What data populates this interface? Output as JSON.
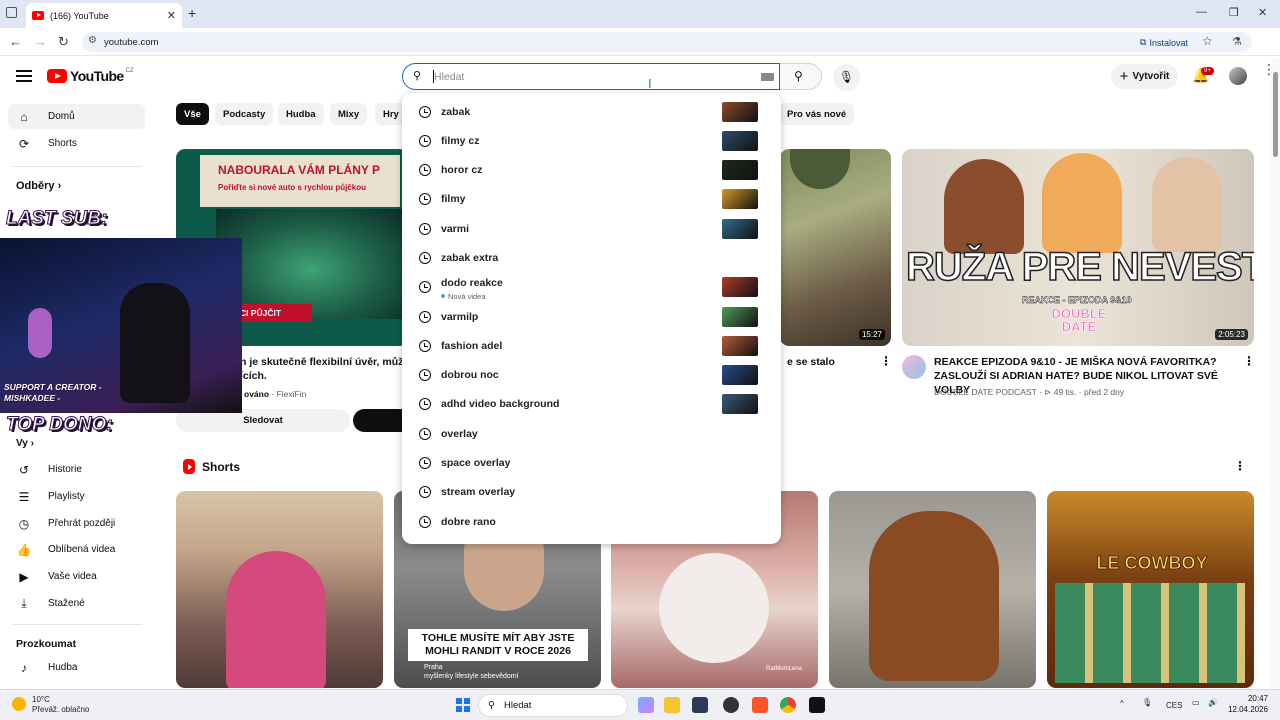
{
  "browser": {
    "tab_title": "(166) YouTube",
    "url": "youtube.com",
    "install_label": "Instalovat"
  },
  "header": {
    "logo_text": "YouTube",
    "country": "CZ",
    "search_placeholder": "Hledat",
    "create_label": "Vytvořit",
    "notifications": "9+"
  },
  "sidebar": {
    "top": [
      {
        "label": "Domů",
        "icon": "home-icon"
      },
      {
        "label": "Shorts",
        "icon": "shorts-icon"
      }
    ],
    "subs_heading": "Odběry",
    "you_heading": "Vy",
    "you": [
      {
        "label": "Historie",
        "icon": "history-icon"
      },
      {
        "label": "Playlisty",
        "icon": "playlist-icon"
      },
      {
        "label": "Přehrát později",
        "icon": "watch-later-icon"
      },
      {
        "label": "Oblíbená videa",
        "icon": "like-icon"
      },
      {
        "label": "Vaše videa",
        "icon": "your-videos-icon"
      },
      {
        "label": "Stažené",
        "icon": "download-icon"
      }
    ],
    "explore_heading": "Prozkoumat",
    "explore": [
      {
        "label": "Hudba",
        "icon": "music-icon"
      }
    ]
  },
  "chips": [
    "Vše",
    "Podcasty",
    "Hudba",
    "Mixy",
    "Hry",
    "Pro vás nové"
  ],
  "search_suggestions": [
    {
      "text": "zabak"
    },
    {
      "text": "filmy cz"
    },
    {
      "text": "horor cz"
    },
    {
      "text": "filmy"
    },
    {
      "text": "varmi"
    },
    {
      "text": "zabak extra"
    },
    {
      "text": "dodo reakce",
      "sub": "Nová videa"
    },
    {
      "text": "varmilp"
    },
    {
      "text": "fashion adel"
    },
    {
      "text": "dobrou noc"
    },
    {
      "text": "adhd video background"
    },
    {
      "text": "overlay"
    },
    {
      "text": "space overlay"
    },
    {
      "text": "stream overlay"
    },
    {
      "text": "dobre rano"
    }
  ],
  "videos": {
    "ad": {
      "banner_line1": "NABOURALA VÁM PLÁNY P",
      "banner_line2": "Pořiďte si nové auto s rychlou půjčkou",
      "cta_partial": "CI PŮJČIT",
      "title_partial": "n je skutečně flexibilní úvěr, můžet",
      "title_partial2": "ících.",
      "sponsor": "ováno",
      "advertiser": "FlexiFin",
      "follow_label": "Sledovat"
    },
    "second": {
      "duration": "15:27",
      "title_partial": "e se stalo"
    },
    "third": {
      "thumb_big": "RUŽA PRE NEVESTU",
      "thumb_small": "REAKCE - EPIZODA 9&10",
      "thumb_logo": "DOUBLE DATE",
      "duration": "2:05:23",
      "title": "REAKCE EPIZODA 9&10 - JE MIŠKA NOVÁ FAVORITKA? ZASLOUŽÍ SI ADRIAN HATE? BUDE NIKOL LITOVAT SVÉ VOLBY",
      "channel": "DOUBLE DATE PODCAST",
      "views": "49 tis.",
      "age": "před 2 dny"
    }
  },
  "shorts": {
    "heading": "Shorts",
    "caption2": "TOHLE MUSÍTE MÍT ABY JSTE MOHLI RANDIT V ROCE 2026",
    "sub2_line1": "Praha",
    "sub2_line2": "myšlenky lifestyle sebevědomí",
    "watermark3": "RatMomLena",
    "title5": "LE COWBOY"
  },
  "overlay": {
    "last_sub": "LAST SUB:",
    "support": "SUPPORT A CREATOR - MISHKADEE -",
    "top_dono": "TOP DONO:"
  },
  "taskbar": {
    "temp": "10°C",
    "weather": "Převáž. oblačno",
    "search": "Hledat",
    "lang": "CES",
    "time": "20:47",
    "date": "12.04.2026"
  },
  "colors": {
    "brand": "#ff0000",
    "focus": "#1c62b9",
    "chip_selected": "#0f0f0f",
    "ad_green": "#1e7a55"
  }
}
